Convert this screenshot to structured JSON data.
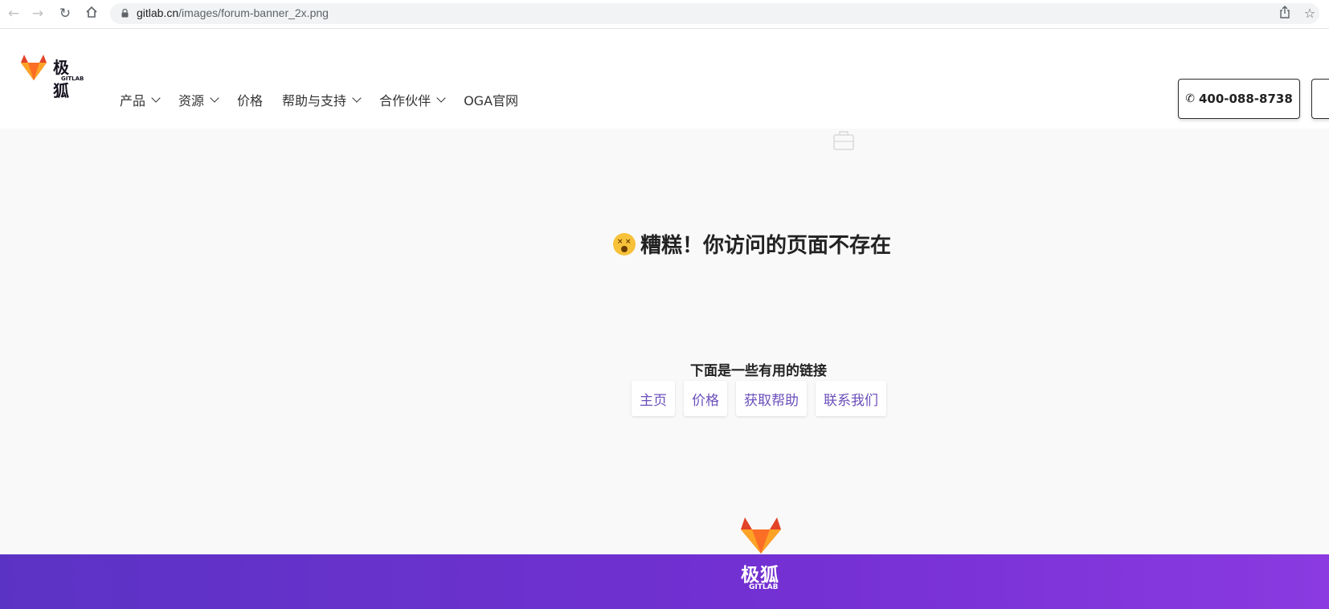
{
  "browser": {
    "url_host": "gitlab.cn",
    "url_path": "/images/forum-banner_2x.png",
    "back_icon": "arrow-left-icon",
    "forward_icon": "arrow-right-icon",
    "reload_icon": "reload-icon",
    "home_icon": "home-icon",
    "share_icon": "share-icon",
    "bookmark_icon": "star-icon"
  },
  "header": {
    "logo_cn": "极狐",
    "logo_en": "GITLAB",
    "nav": [
      {
        "label": "产品",
        "dropdown": true
      },
      {
        "label": "资源",
        "dropdown": true
      },
      {
        "label": "价格",
        "dropdown": false
      },
      {
        "label": "帮助与支持",
        "dropdown": true
      },
      {
        "label": "合作伙伴",
        "dropdown": true
      },
      {
        "label": "OGA官网",
        "dropdown": false
      }
    ],
    "phone": "400-088-8738"
  },
  "main": {
    "title": "糟糕！你访问的页面不存在",
    "links_caption": "下面是一些有用的链接",
    "links": [
      "主页",
      "价格",
      "获取帮助",
      "联系我们"
    ]
  },
  "footer": {
    "logo_cn": "极狐",
    "logo_en": "GITLAB"
  },
  "colors": {
    "accent": "#6b4fbb",
    "footer_start": "#5b33c4",
    "footer_end": "#8a3ae0",
    "fox_orange": "#e24329",
    "fox_light": "#fca326"
  }
}
